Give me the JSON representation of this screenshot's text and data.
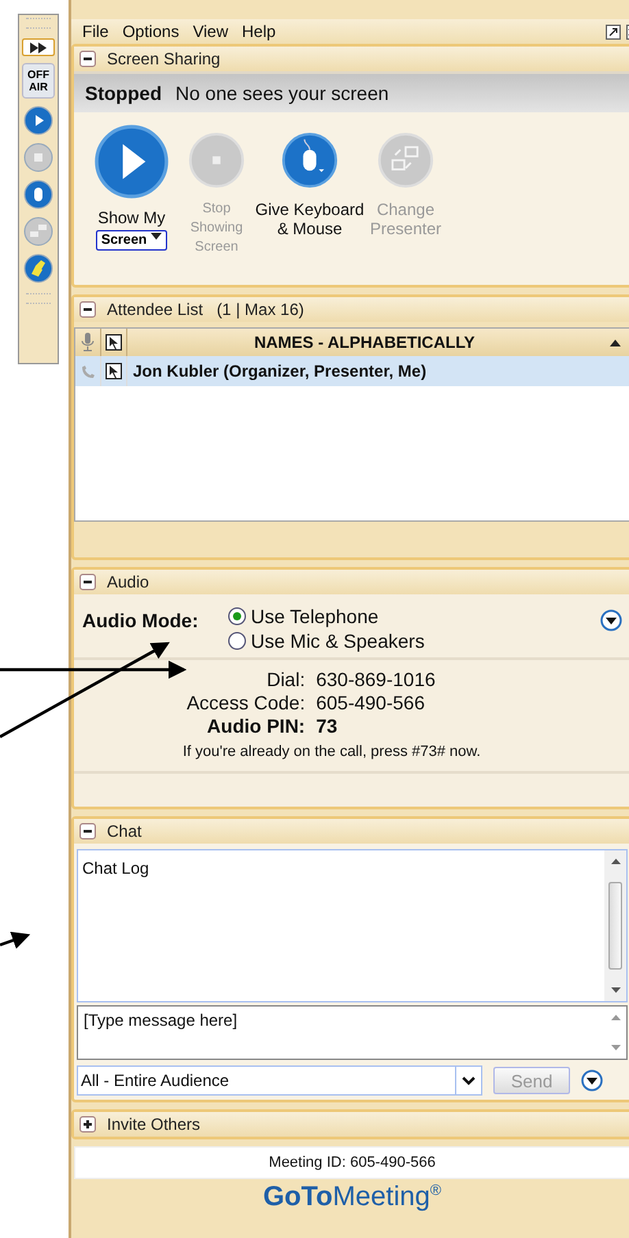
{
  "toolbar": {
    "items": [
      {
        "kind": "expand"
      },
      {
        "kind": "offair",
        "label": "OFF AIR"
      },
      {
        "kind": "play",
        "disabled": false
      },
      {
        "kind": "stop",
        "disabled": true
      },
      {
        "kind": "mouse",
        "disabled": false
      },
      {
        "kind": "presenter",
        "disabled": true
      },
      {
        "kind": "highlighter",
        "disabled": false
      }
    ]
  },
  "menu": [
    "File",
    "Options",
    "View",
    "Help"
  ],
  "screen_sharing": {
    "title": "Screen Sharing",
    "status": "Stopped",
    "status_text": "No one sees your screen",
    "buttons": [
      {
        "kind": "play",
        "label": "Show My",
        "dropdown": "Screen",
        "disabled": false
      },
      {
        "kind": "stop",
        "label": "Stop Showing Screen",
        "disabled": true
      },
      {
        "kind": "mouse",
        "label": "Give Keyboard & Mouse",
        "disabled": false
      },
      {
        "kind": "presenter",
        "label": "Change Presenter",
        "disabled": true
      }
    ]
  },
  "attendee_list": {
    "title": "Attendee List",
    "count": "(1 | Max 16)",
    "column": "NAMES - ALPHABETICALLY",
    "rows": [
      {
        "name": "Jon Kubler (Organizer, Presenter, Me)",
        "selected": true
      }
    ]
  },
  "audio": {
    "title": "Audio",
    "mode_label": "Audio Mode:",
    "options": [
      {
        "label": "Use Telephone",
        "selected": true
      },
      {
        "label": "Use Mic & Speakers",
        "selected": false
      }
    ],
    "info": [
      {
        "label": "Dial:",
        "value": "630-869-1016",
        "emphasis": false
      },
      {
        "label": "Access Code:",
        "value": "605-490-566",
        "emphasis": false
      },
      {
        "label": "Audio PIN:",
        "value": "73",
        "emphasis": true
      }
    ],
    "note": "If you're already on the call, press #73# now."
  },
  "chat": {
    "title": "Chat",
    "log": "Chat Log",
    "placeholder": "[Type message here]",
    "recipient": "All - Entire Audience",
    "send": "Send",
    "send_disabled": true
  },
  "invite": {
    "title": "Invite Others",
    "expanded": false
  },
  "meeting_id": "Meeting ID: 605-490-566",
  "logo": {
    "bold": "GoTo",
    "light": "Meeting",
    "mark": "®"
  }
}
